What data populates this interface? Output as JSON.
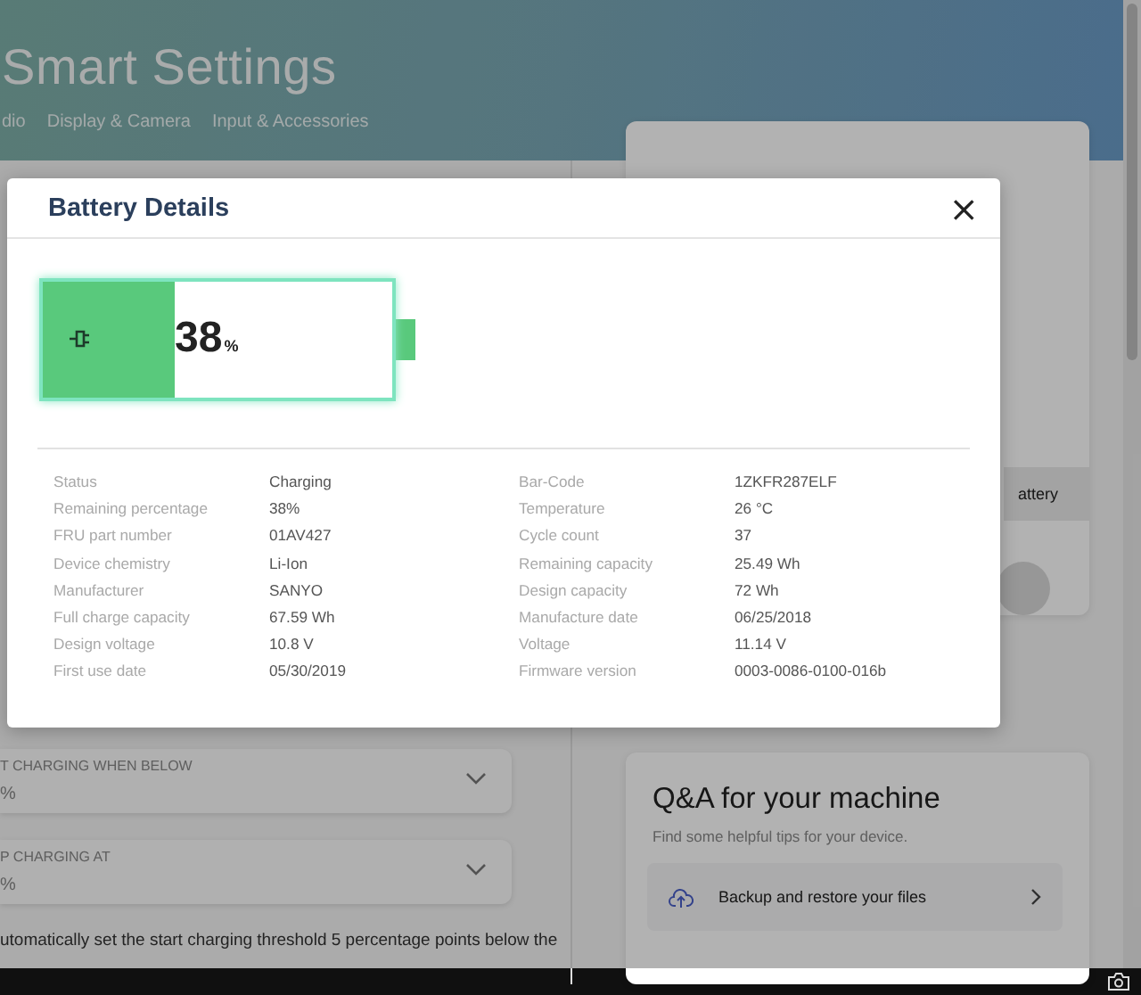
{
  "app": {
    "title": "Smart Settings",
    "tabs": [
      {
        "label": "dio",
        "selected": false
      },
      {
        "label": "Display & Camera",
        "selected": false
      },
      {
        "label": "Input & Accessories",
        "selected": false
      }
    ]
  },
  "left_panel": {
    "dropdowns": [
      {
        "label": "T CHARGING WHEN BELOW",
        "value": "%"
      },
      {
        "label": "P CHARGING AT",
        "value": "%"
      }
    ],
    "note": "utomatically set the start charging threshold 5 percentage points below the"
  },
  "right_panel": {
    "battery_card": {
      "button": "attery"
    },
    "qa_card": {
      "title": "Q&A for your machine",
      "subtitle": "Find some helpful tips for your device.",
      "items": [
        {
          "label": "Backup and restore your files"
        }
      ]
    }
  },
  "dialog": {
    "title": "Battery Details",
    "close": "×",
    "battery": {
      "level": 0.38,
      "percent": "38",
      "unit": "%",
      "charging": true
    },
    "details": [
      {
        "label": "Status",
        "value": "Charging"
      },
      {
        "label": "Bar-Code",
        "value": "1ZKFR287ELF"
      },
      {
        "label": "Remaining percentage",
        "value": "38%"
      },
      {
        "label": "Temperature",
        "value": "26 °C"
      },
      {
        "label": "FRU part number",
        "value": "01AV427"
      },
      {
        "label": "Cycle count",
        "value": "37"
      },
      {
        "label": "Device chemistry",
        "value": "Li-Ion"
      },
      {
        "label": "Remaining capacity",
        "value": "25.49 Wh"
      },
      {
        "label": "Manufacturer",
        "value": "SANYO"
      },
      {
        "label": "Design capacity",
        "value": "72 Wh"
      },
      {
        "label": "Full charge capacity",
        "value": "67.59 Wh"
      },
      {
        "label": "Manufacture date",
        "value": "06/25/2018"
      },
      {
        "label": "Design voltage",
        "value": "10.8 V"
      },
      {
        "label": "Voltage",
        "value": "11.14 V"
      },
      {
        "label": "First use date",
        "value": "05/30/2019"
      },
      {
        "label": "Firmware version",
        "value": "0003-0086-0100-016b"
      }
    ]
  }
}
